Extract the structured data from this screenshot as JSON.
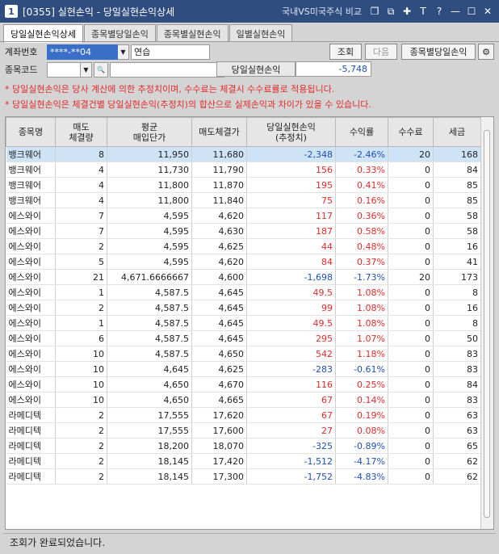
{
  "window": {
    "number": "1",
    "title": "[0355] 실현손익 - 당일실현손익상세",
    "link": "국내VS미국주식 비교"
  },
  "tabs": [
    "당일실현손익상세",
    "종목별당일손익",
    "종목별실현손익",
    "일별실현손익"
  ],
  "form": {
    "account_label": "계좌번호",
    "account_value": "****-**04",
    "account_name": "연습",
    "code_label": "종목코드",
    "search_btn": "조회",
    "next_btn": "다음",
    "by_stock_btn": "종목별당일손익",
    "summary_label": "당일실현손익",
    "summary_value": "-5,748"
  },
  "notes": [
    "* 당일실현손익은 당사 계산에 의한 추정치이며, 수수료는 체결시 수수료률로 적용됩니다.",
    "* 당일실현손익은 체결건별 당일실현손익(추정치)의 합산으로 실제손익과 차이가 있을 수 있습니다."
  ],
  "columns": [
    "종목명",
    "매도\n체결량",
    "평균\n매입단가",
    "매도체결가",
    "당일실현손익\n(추정치)",
    "수익률",
    "수수료",
    "세금"
  ],
  "rows": [
    [
      "뱅크웨어",
      "8",
      "11,950",
      "11,680",
      "-2,348",
      "-2.46%",
      "20",
      "168"
    ],
    [
      "뱅크웨어",
      "4",
      "11,730",
      "11,790",
      "156",
      "0.33%",
      "0",
      "84"
    ],
    [
      "뱅크웨어",
      "4",
      "11,800",
      "11,870",
      "195",
      "0.41%",
      "0",
      "85"
    ],
    [
      "뱅크웨어",
      "4",
      "11,800",
      "11,840",
      "75",
      "0.16%",
      "0",
      "85"
    ],
    [
      "에스와이",
      "7",
      "4,595",
      "4,620",
      "117",
      "0.36%",
      "0",
      "58"
    ],
    [
      "에스와이",
      "7",
      "4,595",
      "4,630",
      "187",
      "0.58%",
      "0",
      "58"
    ],
    [
      "에스와이",
      "2",
      "4,595",
      "4,625",
      "44",
      "0.48%",
      "0",
      "16"
    ],
    [
      "에스와이",
      "5",
      "4,595",
      "4,620",
      "84",
      "0.37%",
      "0",
      "41"
    ],
    [
      "에스와이",
      "21",
      "4,671.6666667",
      "4,600",
      "-1,698",
      "-1.73%",
      "20",
      "173"
    ],
    [
      "에스와이",
      "1",
      "4,587.5",
      "4,645",
      "49.5",
      "1.08%",
      "0",
      "8"
    ],
    [
      "에스와이",
      "2",
      "4,587.5",
      "4,645",
      "99",
      "1.08%",
      "0",
      "16"
    ],
    [
      "에스와이",
      "1",
      "4,587.5",
      "4,645",
      "49.5",
      "1.08%",
      "0",
      "8"
    ],
    [
      "에스와이",
      "6",
      "4,587.5",
      "4,645",
      "295",
      "1.07%",
      "0",
      "50"
    ],
    [
      "에스와이",
      "10",
      "4,587.5",
      "4,650",
      "542",
      "1.18%",
      "0",
      "83"
    ],
    [
      "에스와이",
      "10",
      "4,645",
      "4,625",
      "-283",
      "-0.61%",
      "0",
      "83"
    ],
    [
      "에스와이",
      "10",
      "4,650",
      "4,670",
      "116",
      "0.25%",
      "0",
      "84"
    ],
    [
      "에스와이",
      "10",
      "4,650",
      "4,665",
      "67",
      "0.14%",
      "0",
      "83"
    ],
    [
      "라메디텍",
      "2",
      "17,555",
      "17,620",
      "67",
      "0.19%",
      "0",
      "63"
    ],
    [
      "라메디텍",
      "2",
      "17,555",
      "17,600",
      "27",
      "0.08%",
      "0",
      "63"
    ],
    [
      "라메디텍",
      "2",
      "18,200",
      "18,070",
      "-325",
      "-0.89%",
      "0",
      "65"
    ],
    [
      "라메디텍",
      "2",
      "18,145",
      "17,420",
      "-1,512",
      "-4.17%",
      "0",
      "62"
    ],
    [
      "라메디텍",
      "2",
      "18,145",
      "17,300",
      "-1,752",
      "-4.83%",
      "0",
      "62"
    ]
  ],
  "status": "조회가 완료되었습니다."
}
